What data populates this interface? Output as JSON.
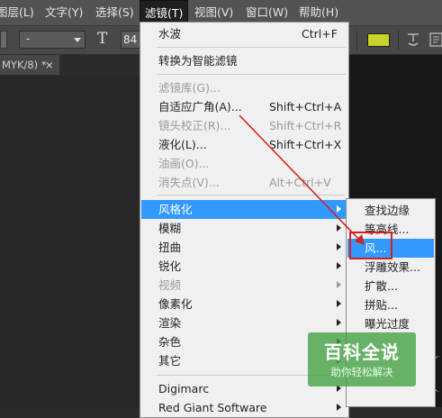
{
  "menubar": {
    "items": [
      {
        "label": "图层(L)"
      },
      {
        "label": "文字(Y)"
      },
      {
        "label": "选择(S)"
      },
      {
        "label": "滤镜(T)"
      },
      {
        "label": "视图(V)"
      },
      {
        "label": "窗口(W)"
      },
      {
        "label": "帮助(H)"
      }
    ]
  },
  "options_bar": {
    "font_family_value": "-",
    "font_size_value": "84",
    "text_color": "#c8d42b"
  },
  "doc_tab": {
    "label": "MYK/8) *",
    "close": "×"
  },
  "filter_menu": {
    "items": [
      {
        "label": "水波",
        "shortcut": "Ctrl+F"
      },
      {
        "label": "转换为智能滤镜"
      },
      {
        "label": "滤镜库(G)..."
      },
      {
        "label": "自适应广角(A)...",
        "shortcut": "Shift+Ctrl+A"
      },
      {
        "label": "镜头校正(R)...",
        "shortcut": "Shift+Ctrl+R"
      },
      {
        "label": "液化(L)...",
        "shortcut": "Shift+Ctrl+X"
      },
      {
        "label": "油画(O)..."
      },
      {
        "label": "消失点(V)...",
        "shortcut": "Alt+Ctrl+V"
      },
      {
        "label": "风格化"
      },
      {
        "label": "模糊"
      },
      {
        "label": "扭曲"
      },
      {
        "label": "锐化"
      },
      {
        "label": "视频"
      },
      {
        "label": "像素化"
      },
      {
        "label": "渲染"
      },
      {
        "label": "杂色"
      },
      {
        "label": "其它"
      },
      {
        "label": "Digimarc"
      },
      {
        "label": "Red Giant Software"
      }
    ]
  },
  "stylize_submenu": {
    "items": [
      {
        "label": "查找边缘"
      },
      {
        "label": "等高线..."
      },
      {
        "label": "风..."
      },
      {
        "label": "浮雕效果..."
      },
      {
        "label": "扩散..."
      },
      {
        "label": "拼贴..."
      },
      {
        "label": "曝光过度"
      }
    ]
  },
  "watermark": {
    "title": "百科全说",
    "subtitle": "助你轻松解决"
  },
  "colors": {
    "highlight": "#3399ff",
    "annotation": "#d42020"
  }
}
